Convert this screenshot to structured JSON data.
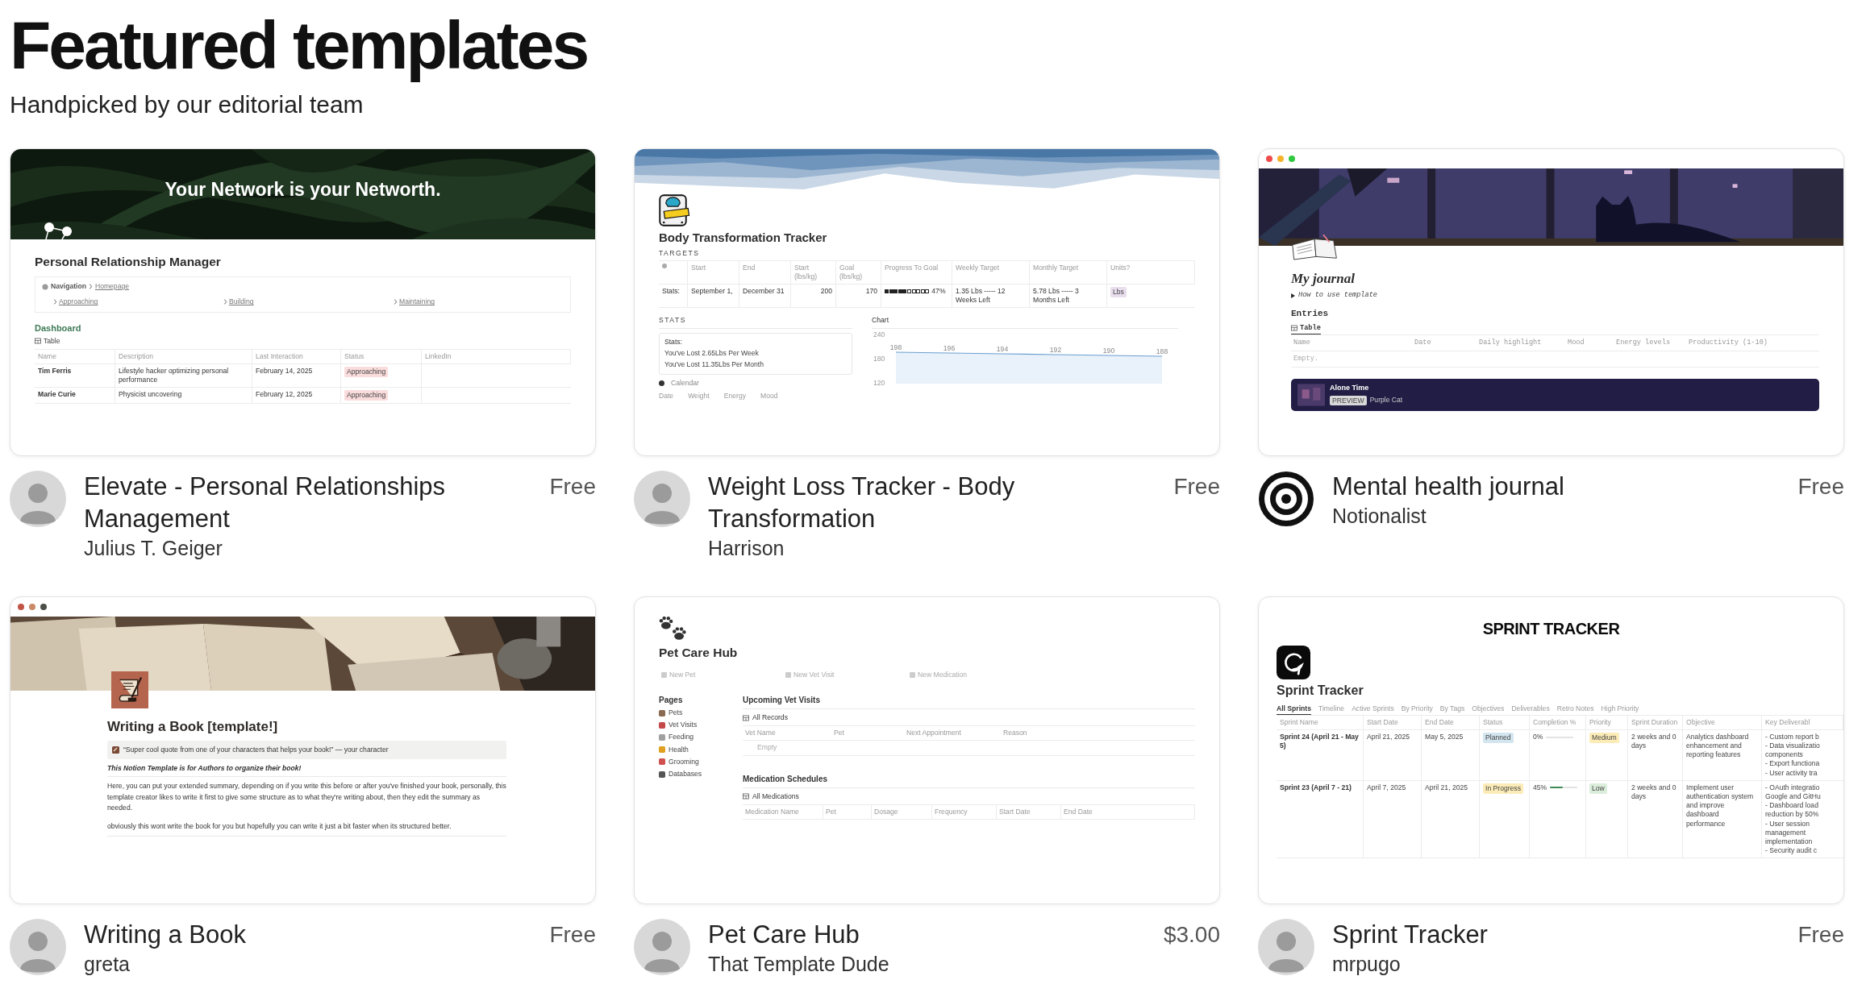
{
  "page": {
    "title": "Featured templates",
    "subtitle": "Handpicked by our editorial team"
  },
  "templates": [
    {
      "name": "Elevate - Personal Relationships Management",
      "author": "Julius T. Geiger",
      "price": "Free",
      "avatar": {
        "kind": "person"
      },
      "preview": {
        "kind": "network",
        "banner_heading": "Your Network is your Networth.",
        "title": "Personal Relationship Manager",
        "nav_label": "Navigation",
        "nav_page": "Homepage",
        "nav_links": [
          "Approaching",
          "Building",
          "Maintaining"
        ],
        "section": "Dashboard",
        "view": "Table",
        "columns": [
          "Name",
          "Description",
          "Last Interaction",
          "Status",
          "LinkedIn"
        ],
        "rows": [
          {
            "name": "Tim Ferris",
            "description": "Lifestyle hacker optimizing personal performance",
            "date": "February 14, 2025",
            "status": {
              "label": "Approaching",
              "color": "#fadcdc"
            }
          },
          {
            "name": "Marie Curie",
            "description": "Physicist uncovering",
            "date": "February 12, 2025",
            "status": {
              "label": "Approaching",
              "color": "#fadcdc"
            }
          }
        ]
      }
    },
    {
      "name": "Weight Loss Tracker - Body Transformation",
      "author": "Harrison",
      "price": "Free",
      "avatar": {
        "kind": "person"
      },
      "preview": {
        "kind": "body",
        "title": "Body Transformation Tracker",
        "targets_label": "TARGETS",
        "target_columns": [
          "Start",
          "End",
          "Start (lbs/kg)",
          "Goal (lbs/kg)",
          "Progress To Goal",
          "Weekly Target",
          "Monthly Target",
          "Units?"
        ],
        "target_row": {
          "label": "Stats:",
          "start": "September 1,",
          "end": "December 31",
          "start_weight": "200",
          "goal_weight": "170",
          "progress": {
            "level": 0.47,
            "reading": "47%"
          },
          "weekly": "1.35 Lbs ----- 12 Weeks Left",
          "monthly": "5.78 Lbs ----- 3 Months Left",
          "units": {
            "label": "Lbs",
            "color": "#e8deee"
          }
        },
        "stats_label": "STATS",
        "stats_heading": "Stats:",
        "stats_lines": [
          "You've Lost 2.65Lbs Per Week",
          "You've Lost 11.35Lbs Per Month"
        ],
        "calendar_tab": "Calendar",
        "calendar_columns": [
          "Date",
          "Weight",
          "Energy",
          "Mood"
        ],
        "chart_label": "Chart",
        "chart_data": {
          "type": "area",
          "categories": [
            null,
            null,
            null,
            null,
            null,
            null
          ],
          "series": [
            {
              "color": "#6a9fd0",
              "values": [
                198,
                196,
                194,
                192,
                190,
                188
              ]
            }
          ],
          "ylim": [
            120,
            240
          ],
          "yticks": [
            {
              "value": 120,
              "label": "120"
            },
            {
              "value": 180,
              "label": "180"
            },
            {
              "value": 240,
              "label": "240"
            }
          ],
          "data_labels": true
        }
      }
    },
    {
      "name": "Mental health journal",
      "author": "Notionalist",
      "price": "Free",
      "avatar": {
        "kind": "rings"
      },
      "preview": {
        "kind": "journal",
        "title": "My journal",
        "toggle": "How to use template",
        "section": "Entries",
        "view": "Table",
        "columns": [
          "Name",
          "Date",
          "Daily highlight",
          "Mood",
          "Energy levels",
          "Productivity (1-10)"
        ],
        "empty": "Empty.",
        "player": {
          "track": "Alone Time",
          "badge": "PREVIEW",
          "artist": "Purple Cat"
        }
      }
    },
    {
      "name": "Writing a Book",
      "author": "greta",
      "price": "Free",
      "avatar": {
        "kind": "person"
      },
      "preview": {
        "kind": "book",
        "title": "Writing a Book [template!]",
        "quote": "“Super cool quote from one of your characters that helps your book!” — your character",
        "lead": "This Notion Template is for Authors to organize their book!",
        "paragraphs": [
          "Here, you can put your extended summary, depending on if you write this before or after you've finished your book, personally, this template creator likes to write it first to give some structure as to what they're writing about, then they edit the summary as needed.",
          "obviously this wont write the book for you but hopefully you can write it just a bit faster when its structured better."
        ]
      }
    },
    {
      "name": "Pet Care Hub",
      "author": "That Template Dude",
      "price": "$3.00",
      "avatar": {
        "kind": "person"
      },
      "preview": {
        "kind": "pet",
        "title": "Pet Care Hub",
        "buttons": [
          "New Pet",
          "New Vet Visit",
          "New Medication"
        ],
        "pages_label": "Pages",
        "pages": [
          "Pets",
          "Vet Visits",
          "Feeding",
          "Health",
          "Grooming",
          "Databases"
        ],
        "sections": [
          {
            "heading": "Upcoming Vet Visits",
            "view": "All Records",
            "columns": [
              "Vet Name",
              "Pet",
              "Next Appointment",
              "Reason"
            ],
            "empty": "Empty"
          },
          {
            "heading": "Medication Schedules",
            "view": "All Medications",
            "columns": [
              "Medication Name",
              "Pet",
              "Dosage",
              "Frequency",
              "Start Date",
              "End Date"
            ]
          }
        ]
      }
    },
    {
      "name": "Sprint Tracker",
      "author": "mrpugo",
      "price": "Free",
      "avatar": {
        "kind": "person"
      },
      "preview": {
        "kind": "sprint",
        "banner": "SPRINT TRACKER",
        "title": "Sprint Tracker",
        "views": [
          {
            "label": "All Sprints",
            "selected": true
          },
          {
            "label": "Timeline",
            "selected": false
          },
          {
            "label": "Active Sprints",
            "selected": false
          },
          {
            "label": "By Priority",
            "selected": false
          },
          {
            "label": "By Tags",
            "selected": false
          },
          {
            "label": "Objectives",
            "selected": false
          },
          {
            "label": "Deliverables",
            "selected": false
          },
          {
            "label": "Retro Notes",
            "selected": false
          },
          {
            "label": "High Priority",
            "selected": false
          }
        ],
        "columns": [
          "Sprint Name",
          "Start Date",
          "End Date",
          "Status",
          "Completion %",
          "Priority",
          "Sprint Duration",
          "Objective",
          "Key Deliverabl"
        ],
        "rows": [
          {
            "name": "Sprint 24 (April 21 - May 5)",
            "start": "April 21, 2025",
            "end": "May 5, 2025",
            "status": {
              "label": "Planned",
              "color": "#d3e5ef"
            },
            "completion": {
              "reading": "0%"
            },
            "priority": {
              "label": "Medium",
              "color": "#fbecb8"
            },
            "duration": "2 weeks and 0 days",
            "objective": "Analytics dashboard enhancement and reporting features",
            "deliverables": [
              "- Custom report b",
              "- Data visualizatio",
              "components",
              "- Export functiona",
              "- User activity tra"
            ]
          },
          {
            "name": "Sprint 23 (April 7 - 21)",
            "start": "April 7, 2025",
            "end": "April 21, 2025",
            "status": {
              "label": "In Progress",
              "color": "#fbecb8"
            },
            "completion": {
              "level": 0.45,
              "reading": "45%"
            },
            "priority": {
              "label": "Low",
              "color": "#dbeddb"
            },
            "duration": "2 weeks and 0 days",
            "objective": "Implement user authentication system and improve dashboard performance",
            "deliverables": [
              "- OAuth integratio",
              "Google and GitHu",
              "- Dashboard load",
              "reduction by 50%",
              "- User session",
              "management",
              "implementation",
              "- Security audit c"
            ]
          }
        ]
      }
    }
  ]
}
